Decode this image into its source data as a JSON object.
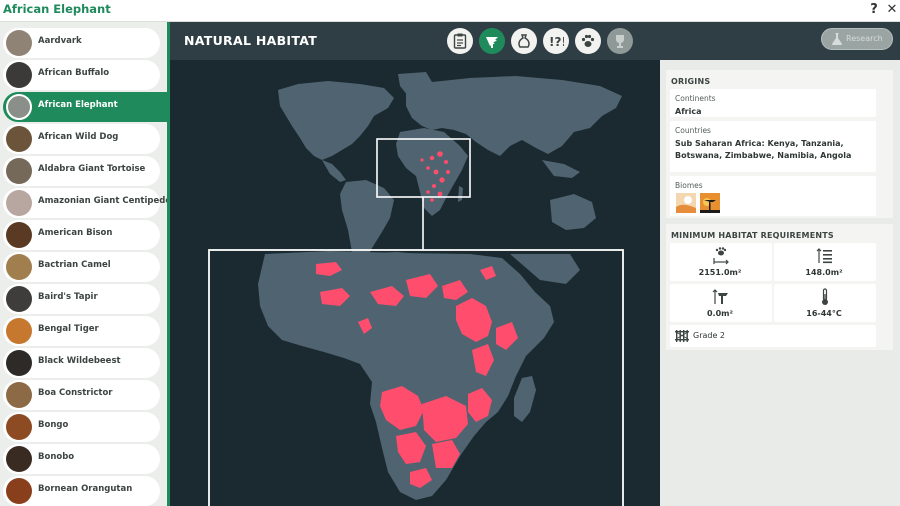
{
  "window": {
    "title": "African Elephant",
    "help_glyph": "?",
    "close_glyph": "✕"
  },
  "sidebar": {
    "items": [
      {
        "label": "Aardvark",
        "color": "#8f8375"
      },
      {
        "label": "African Buffalo",
        "color": "#3b3a38"
      },
      {
        "label": "African Elephant",
        "color": "#8a8f8a",
        "active": true
      },
      {
        "label": "African Wild Dog",
        "color": "#6b5439"
      },
      {
        "label": "Aldabra Giant Tortoise",
        "color": "#75695a"
      },
      {
        "label": "Amazonian Giant Centipede",
        "color": "#b7a7a0"
      },
      {
        "label": "American Bison",
        "color": "#5a3a22"
      },
      {
        "label": "Bactrian Camel",
        "color": "#a17e4e"
      },
      {
        "label": "Baird's Tapir",
        "color": "#3f3d3b"
      },
      {
        "label": "Bengal Tiger",
        "color": "#c6782e"
      },
      {
        "label": "Black Wildebeest",
        "color": "#2d2a27"
      },
      {
        "label": "Boa Constrictor",
        "color": "#8b6a45"
      },
      {
        "label": "Bongo",
        "color": "#8d4b24"
      },
      {
        "label": "Bonobo",
        "color": "#3a2b22"
      },
      {
        "label": "Bornean Orangutan",
        "color": "#8a3f1c"
      }
    ]
  },
  "main": {
    "title": "NATURAL HABITAT",
    "tabs": [
      {
        "name": "tab-info",
        "icon": "clipboard-icon"
      },
      {
        "name": "tab-habitat",
        "icon": "tree-icon",
        "active": true
      },
      {
        "name": "tab-food",
        "icon": "sack-icon"
      },
      {
        "name": "tab-behaviour",
        "icon": "exclamation-icon"
      },
      {
        "name": "tab-enrichment",
        "icon": "paw-icon"
      },
      {
        "name": "tab-trophy",
        "icon": "trophy-icon",
        "disabled": true
      }
    ],
    "research_label": "Research"
  },
  "origins": {
    "title": "ORIGINS",
    "continents_label": "Continents",
    "continents_value": "Africa",
    "countries_label": "Countries",
    "countries_value": "Sub Saharan Africa: Kenya, Tanzania, Botswana, Zimbabwe, Namibia, Angola",
    "biomes_label": "Biomes",
    "biomes": [
      "desert-biome-icon",
      "savanna-biome-icon"
    ]
  },
  "requirements": {
    "title": "MINIMUM HABITAT REQUIREMENTS",
    "land_area": "2151.0m²",
    "climbing_area": "148.0m²",
    "water_area": "0.0m²",
    "temperature": "16-44°C",
    "barrier_grade": "Grade 2"
  },
  "colors": {
    "accent": "#1f8a5c",
    "range": "#ff4d6d",
    "land": "#4f6470",
    "sea": "#1b2a30"
  }
}
